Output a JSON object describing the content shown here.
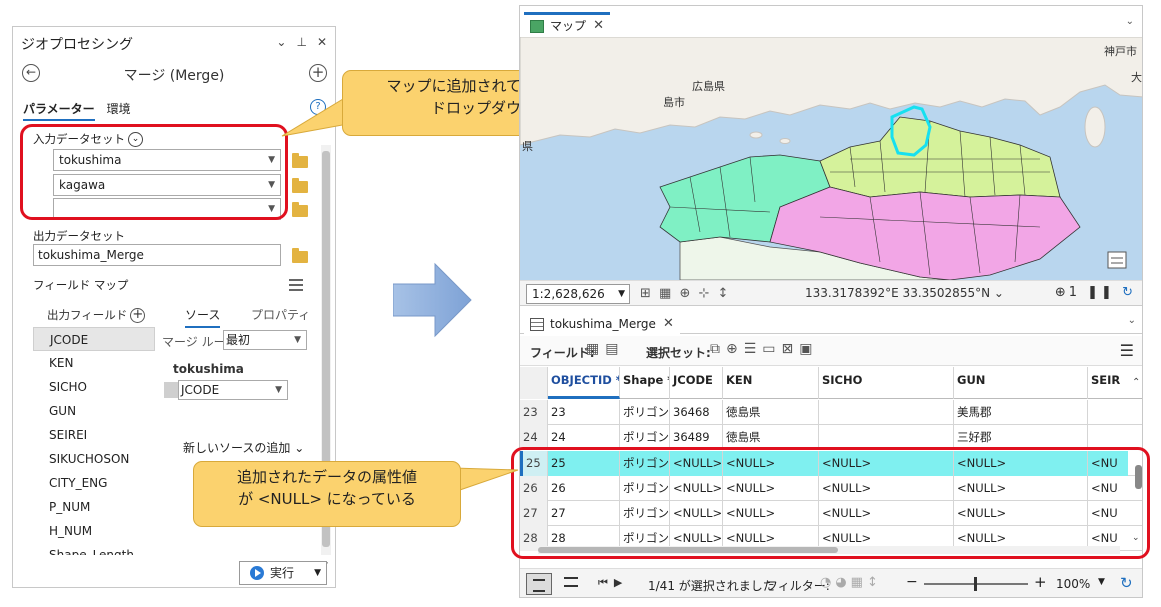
{
  "geoprocessing": {
    "pane_title": "ジオプロセシング",
    "pane_icons": [
      "⌄",
      "⊥",
      "✕"
    ],
    "tool_name": "マージ (Merge)",
    "tabs": [
      "パラメーター",
      "環境"
    ],
    "input_label": "入力データセット",
    "inputs": [
      "tokushima",
      "kagawa",
      ""
    ],
    "output_label": "出力データセット",
    "output_value": "tokushima_Merge",
    "field_map_label": "フィールド マップ",
    "output_fields_label": "出力フィールド",
    "source_tab": "ソース",
    "property_tab": "プロパティ",
    "fields": [
      "JCODE",
      "KEN",
      "SICHO",
      "GUN",
      "SEIREI",
      "SIKUCHOSON",
      "CITY_ENG",
      "P_NUM",
      "H_NUM",
      "Shape_Length"
    ],
    "merge_rule_label": "マージ ルール",
    "merge_rule_value": "最初",
    "source_name": "tokushima",
    "source_field": "JCODE",
    "add_source": "新しいソースの追加 ⌄",
    "run_label": "実行"
  },
  "callouts": {
    "dropdown": [
      "マップに追加されているレイヤーを",
      "ドロップダウンで選択"
    ],
    "null": [
      "追加されたデータの属性値",
      "が <NULL> になっている"
    ]
  },
  "map": {
    "tab_label": "マップ",
    "labels": {
      "hiroshima_ken": "広島県",
      "hiroshima_shi": "島市",
      "kobe": "神戸市",
      "left_frag": "県",
      "right_frag": "大"
    },
    "scale": "1:2,628,626",
    "coords": "133.3178392°E 33.3502855°N",
    "selected_count_icon": "1",
    "colors": {
      "water": "#b9d6ee",
      "land": "#f2efe9",
      "kagawa": "#d5f29b",
      "tokushima": "#f2a6e6",
      "ehime": "#7ff0c4",
      "kochi": "#eef6ea",
      "selection": "#16e0f0"
    }
  },
  "table": {
    "tab_label": "tokushima_Merge",
    "field_label": "フィールド:",
    "selection_label": "選択セット:",
    "columns": [
      "",
      "OBJECTID *",
      "Shape *",
      "JCODE",
      "KEN",
      "SICHO",
      "GUN",
      "SEIR"
    ],
    "rows": [
      [
        "23",
        "23",
        "ポリゴン",
        "36468",
        "徳島県",
        "",
        "美馬郡",
        ""
      ],
      [
        "24",
        "24",
        "ポリゴン",
        "36489",
        "徳島県",
        "",
        "三好郡",
        ""
      ],
      [
        "25",
        "25",
        "ポリゴン",
        "<NULL>",
        "<NULL>",
        "<NULL>",
        "<NULL>",
        "<NU"
      ],
      [
        "26",
        "26",
        "ポリゴン",
        "<NULL>",
        "<NULL>",
        "<NULL>",
        "<NULL>",
        "<NU"
      ],
      [
        "27",
        "27",
        "ポリゴン",
        "<NULL>",
        "<NULL>",
        "<NULL>",
        "<NULL>",
        "<NU"
      ],
      [
        "28",
        "28",
        "ポリゴン",
        "<NULL>",
        "<NULL>",
        "<NULL>",
        "<NULL>",
        "<NU"
      ]
    ],
    "highlight_row": 2,
    "status_count": "1/41 が選択されました",
    "filter_label": "フィルター:",
    "zoom": "100%"
  }
}
